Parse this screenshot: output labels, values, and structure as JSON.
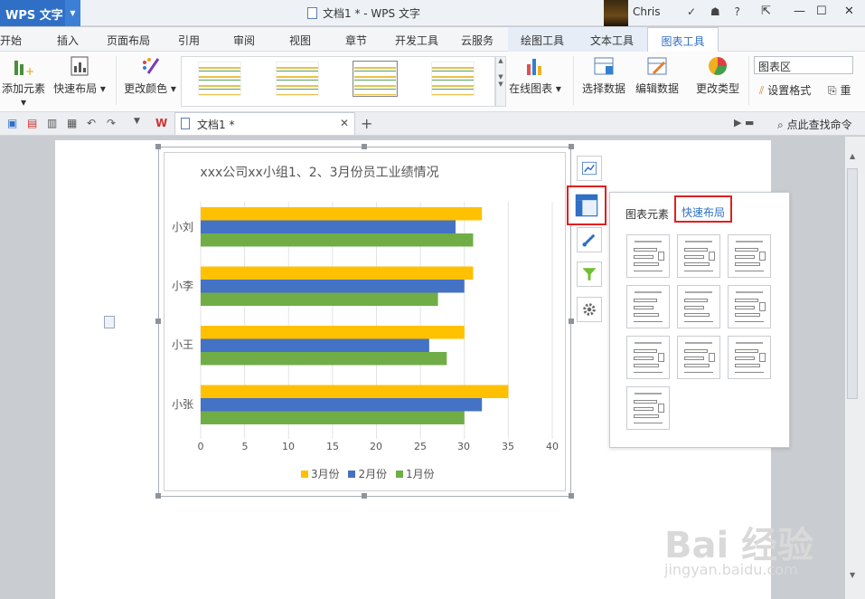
{
  "app": {
    "name": "WPS 文字",
    "window_title": "文档1 * - WPS 文字",
    "user": "Chris"
  },
  "menu": {
    "items": [
      "开始",
      "插入",
      "页面布局",
      "引用",
      "审阅",
      "视图",
      "章节",
      "开发工具",
      "云服务"
    ],
    "context_tabs": [
      "绘图工具",
      "文本工具",
      "图表工具"
    ],
    "active": "图表工具"
  },
  "ribbon": {
    "add_element": "添加元素",
    "quick_layout": "快速布局",
    "change_color": "更改颜色",
    "online_chart": "在线图表",
    "select_data": "选择数据",
    "edit_data": "编辑数据",
    "change_type": "更改类型",
    "chart_area": "图表区",
    "set_format": "设置格式",
    "reset": "重"
  },
  "quick_toolbar": {
    "doc_tab": "文档1 *",
    "search_command": "点此查找命令"
  },
  "chart_data": {
    "type": "bar",
    "title": "xxx公司xx小组1、2、3月份员工业绩情况",
    "categories": [
      "小刘",
      "小李",
      "小王",
      "小张"
    ],
    "series": [
      {
        "name": "3月份",
        "values": [
          32,
          31,
          30,
          35
        ],
        "color": "#ffc000"
      },
      {
        "name": "2月份",
        "values": [
          29,
          30,
          26,
          32
        ],
        "color": "#4472c4"
      },
      {
        "name": "1月份",
        "values": [
          31,
          27,
          28,
          30
        ],
        "color": "#70ad47"
      }
    ],
    "xlim": [
      0,
      40
    ],
    "x_ticks": [
      0,
      5,
      10,
      15,
      20,
      25,
      30,
      35,
      40
    ],
    "grid": true,
    "legend_position": "bottom"
  },
  "panel": {
    "tab_elements": "图表元素",
    "tab_layout": "快速布局"
  },
  "watermark": {
    "line1": "Bai 经验",
    "line2": "jingyan.baidu.com"
  }
}
